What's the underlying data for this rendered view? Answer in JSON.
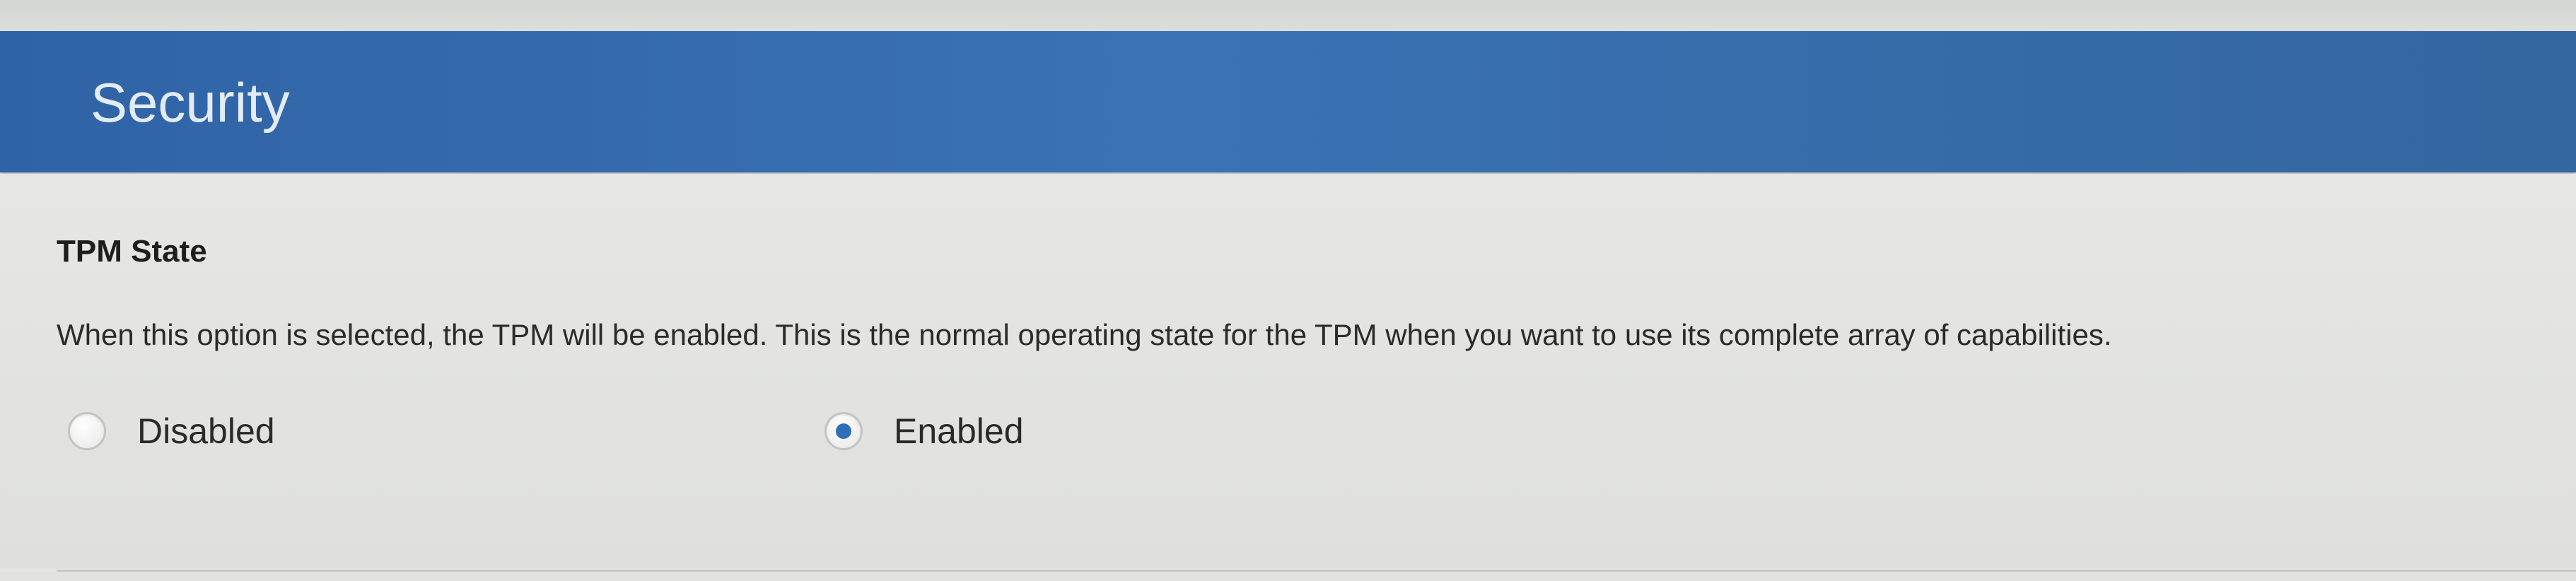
{
  "header": {
    "title": "Security"
  },
  "setting": {
    "title": "TPM State",
    "description": "When this option is selected, the TPM will be enabled. This is the normal operating state for the TPM when you want to use its complete array of capabilities.",
    "options": [
      {
        "label": "Disabled",
        "selected": false
      },
      {
        "label": "Enabled",
        "selected": true
      }
    ]
  },
  "colors": {
    "header_background": "#3a72b4",
    "header_text": "#e3ebf5",
    "page_background": "#e4e5e3",
    "radio_selected_dot": "#2f6fb6"
  }
}
